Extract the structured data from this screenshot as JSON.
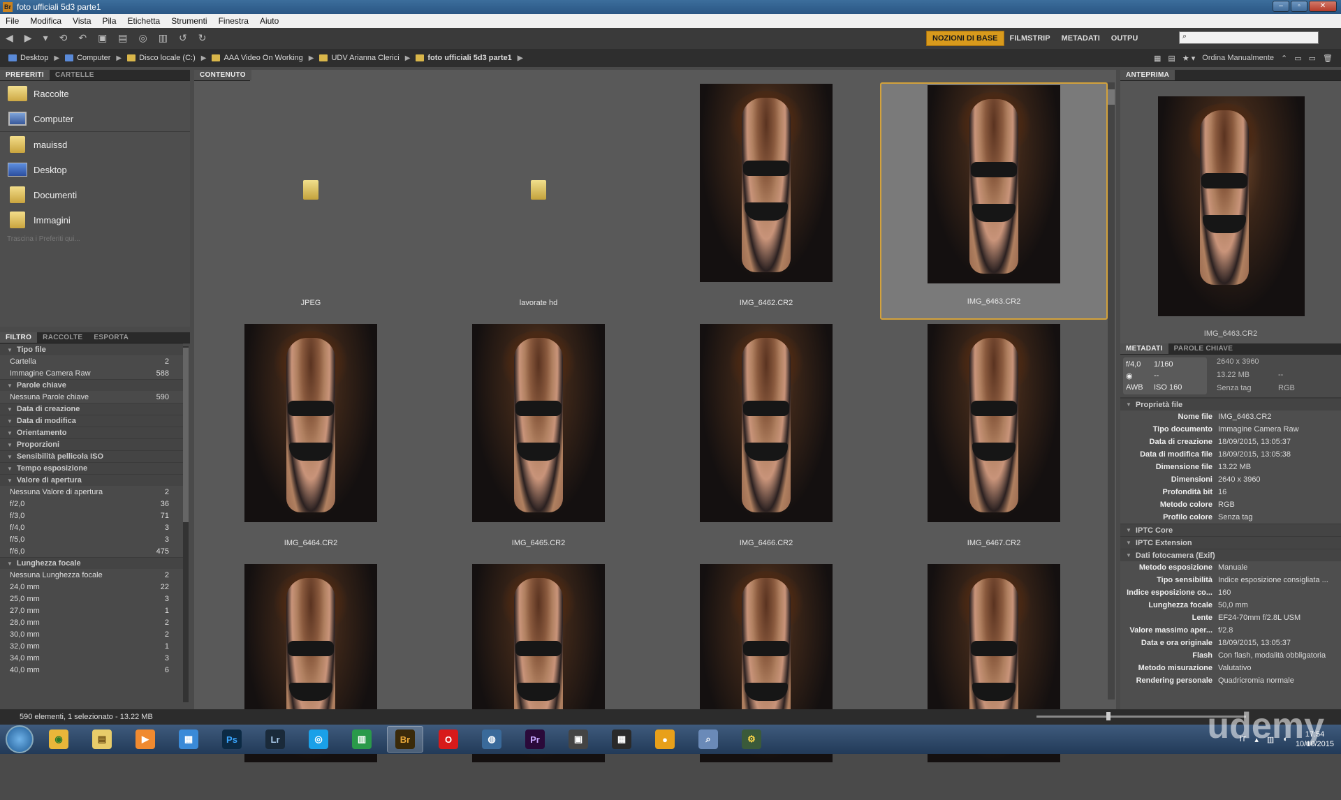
{
  "window": {
    "title": "foto ufficiali 5d3 parte1"
  },
  "menu": [
    "File",
    "Modifica",
    "Vista",
    "Pila",
    "Etichetta",
    "Strumenti",
    "Finestra",
    "Aiuto"
  ],
  "workspaces": {
    "items": [
      "NOZIONI DI BASE",
      "FILMSTRIP",
      "METADATI",
      "OUTPU"
    ],
    "active": 0
  },
  "search": {
    "placeholder": ""
  },
  "breadcrumb": [
    "Desktop",
    "Computer",
    "Disco locale (C:)",
    "AAA Video On Working",
    "UDV Arianna Clerici",
    "foto ufficiali 5d3 parte1"
  ],
  "sort": {
    "label": "Ordina Manualmente"
  },
  "left_top": {
    "tabs": [
      "PREFERITI",
      "CARTELLE"
    ],
    "favorites": [
      {
        "label": "Raccolte",
        "icon": "collections-icon"
      },
      {
        "label": "Computer",
        "icon": "computer-icon"
      },
      {
        "label": "mauissd",
        "icon": "folder-icon"
      },
      {
        "label": "Desktop",
        "icon": "desktop-icon"
      },
      {
        "label": "Documenti",
        "icon": "folder-icon"
      },
      {
        "label": "Immagini",
        "icon": "folder-icon"
      }
    ],
    "drag_hint": "Trascina i Preferiti qui..."
  },
  "filter": {
    "tabs": [
      "FILTRO",
      "RACCOLTE",
      "ESPORTA"
    ],
    "rows": [
      {
        "cat": "Tipo file"
      },
      {
        "label": "Cartella",
        "count": "2"
      },
      {
        "label": "Immagine Camera Raw",
        "count": "588"
      },
      {
        "cat": "Parole chiave"
      },
      {
        "label": "Nessuna Parole chiave",
        "count": "590"
      },
      {
        "cat": "Data di creazione"
      },
      {
        "cat": "Data di modifica"
      },
      {
        "cat": "Orientamento"
      },
      {
        "cat": "Proporzioni"
      },
      {
        "cat": "Sensibilità pellicola ISO"
      },
      {
        "cat": "Tempo esposizione"
      },
      {
        "cat": "Valore di apertura"
      },
      {
        "label": "Nessuna Valore di apertura",
        "count": "2"
      },
      {
        "label": "f/2,0",
        "count": "36"
      },
      {
        "label": "f/3,0",
        "count": "71"
      },
      {
        "label": "f/4,0",
        "count": "3"
      },
      {
        "label": "f/5,0",
        "count": "3"
      },
      {
        "label": "f/6,0",
        "count": "475"
      },
      {
        "cat": "Lunghezza focale"
      },
      {
        "label": "Nessuna Lunghezza focale",
        "count": "2"
      },
      {
        "label": "24,0 mm",
        "count": "22"
      },
      {
        "label": "25,0 mm",
        "count": "3"
      },
      {
        "label": "27,0 mm",
        "count": "1"
      },
      {
        "label": "28,0 mm",
        "count": "2"
      },
      {
        "label": "30,0 mm",
        "count": "2"
      },
      {
        "label": "32,0 mm",
        "count": "1"
      },
      {
        "label": "34,0 mm",
        "count": "3"
      },
      {
        "label": "40,0 mm",
        "count": "6"
      }
    ]
  },
  "content": {
    "tab": "CONTENUTO",
    "items": [
      {
        "name": "JPEG",
        "type": "folder"
      },
      {
        "name": "lavorate hd",
        "type": "folder"
      },
      {
        "name": "IMG_6462.CR2",
        "type": "photo"
      },
      {
        "name": "IMG_6463.CR2",
        "type": "photo",
        "selected": true
      },
      {
        "name": "IMG_6464.CR2",
        "type": "photo"
      },
      {
        "name": "IMG_6465.CR2",
        "type": "photo"
      },
      {
        "name": "IMG_6466.CR2",
        "type": "photo"
      },
      {
        "name": "IMG_6467.CR2",
        "type": "photo"
      },
      {
        "name": "",
        "type": "photo"
      },
      {
        "name": "",
        "type": "photo"
      },
      {
        "name": "",
        "type": "photo"
      },
      {
        "name": "",
        "type": "photo"
      }
    ]
  },
  "preview": {
    "tab": "ANTEPRIMA",
    "caption": "IMG_6463.CR2"
  },
  "metadata": {
    "tabs": [
      "METADATI",
      "PAROLE CHIAVE"
    ],
    "summary": {
      "aperture": "f/4,0",
      "shutter": "1/160",
      "metering": "◉",
      "exposure": "--",
      "wb": "AWB",
      "iso": "ISO 160",
      "dims": "2640 x 3960",
      "size": "13.22 MB",
      "size2": "--",
      "tag": "Senza tag",
      "color": "RGB"
    },
    "file_props_title": "Proprietà file",
    "file_props": [
      {
        "k": "Nome file",
        "v": "IMG_6463.CR2"
      },
      {
        "k": "Tipo documento",
        "v": "Immagine Camera Raw"
      },
      {
        "k": "Data di creazione",
        "v": "18/09/2015, 13:05:37"
      },
      {
        "k": "Data di modifica file",
        "v": "18/09/2015, 13:05:38"
      },
      {
        "k": "Dimensione file",
        "v": "13.22 MB"
      },
      {
        "k": "Dimensioni",
        "v": "2640 x 3960"
      },
      {
        "k": "Profondità bit",
        "v": "16"
      },
      {
        "k": "Metodo colore",
        "v": "RGB"
      },
      {
        "k": "Profilo colore",
        "v": "Senza tag"
      }
    ],
    "sections": [
      "IPTC Core",
      "IPTC Extension",
      "Dati fotocamera (Exif)"
    ],
    "exif": [
      {
        "k": "Metodo esposizione",
        "v": "Manuale"
      },
      {
        "k": "Tipo sensibilità",
        "v": "Indice esposizione consigliata ..."
      },
      {
        "k": "Indice esposizione co...",
        "v": "160"
      },
      {
        "k": "Lunghezza focale",
        "v": "50,0 mm"
      },
      {
        "k": "Lente",
        "v": "EF24-70mm f/2.8L USM"
      },
      {
        "k": "Valore massimo aper...",
        "v": "f/2.8"
      },
      {
        "k": "Data e ora originale",
        "v": "18/09/2015, 13:05:37"
      },
      {
        "k": "Flash",
        "v": "Con flash, modalità obbligatoria"
      },
      {
        "k": "Metodo misurazione",
        "v": "Valutativo"
      },
      {
        "k": "Rendering personale",
        "v": "Quadricromia normale"
      }
    ]
  },
  "status": {
    "text": "590 elementi, 1 selezionato - 13.22 MB"
  },
  "taskbar": {
    "apps": [
      {
        "name": "chrome",
        "glyph": "◉",
        "color": "#e8b63a",
        "fg": "#2a7a2a"
      },
      {
        "name": "explorer",
        "glyph": "▤",
        "color": "#e8cc6a",
        "fg": "#6a4a10"
      },
      {
        "name": "media",
        "glyph": "▶",
        "color": "#f08a30",
        "fg": "#fff"
      },
      {
        "name": "apps",
        "glyph": "▦",
        "color": "#3a8ad8",
        "fg": "#fff"
      },
      {
        "name": "photoshop",
        "glyph": "Ps",
        "color": "#0c2a44",
        "fg": "#3aa6ff"
      },
      {
        "name": "lightroom",
        "glyph": "Lr",
        "color": "#1a2a3a",
        "fg": "#a8c8e8"
      },
      {
        "name": "skype",
        "glyph": "◎",
        "color": "#1aa0e8",
        "fg": "#fff"
      },
      {
        "name": "spreadsheet",
        "glyph": "▥",
        "color": "#2a9a4a",
        "fg": "#fff"
      },
      {
        "name": "bridge",
        "glyph": "Br",
        "color": "#3a2a0a",
        "fg": "#e8a83a",
        "active": true
      },
      {
        "name": "opera",
        "glyph": "O",
        "color": "#d81a1a",
        "fg": "#fff"
      },
      {
        "name": "network",
        "glyph": "◍",
        "color": "#3a6a9a",
        "fg": "#fff"
      },
      {
        "name": "premiere",
        "glyph": "Pr",
        "color": "#2a0a3a",
        "fg": "#c8a8ff"
      },
      {
        "name": "clapper",
        "glyph": "▣",
        "color": "#444",
        "fg": "#fff"
      },
      {
        "name": "film",
        "glyph": "▦",
        "color": "#2a2a2a",
        "fg": "#fff"
      },
      {
        "name": "circle",
        "glyph": "●",
        "color": "#e8a01a",
        "fg": "#fff"
      },
      {
        "name": "search",
        "glyph": "⌕",
        "color": "#6a8ab8",
        "fg": "#fff"
      },
      {
        "name": "tools",
        "glyph": "⚙",
        "color": "#3a5a3a",
        "fg": "#ffd84a"
      }
    ],
    "lang": "IT",
    "time": "17:54",
    "date": "10/10/2015"
  },
  "watermark": "udemy"
}
